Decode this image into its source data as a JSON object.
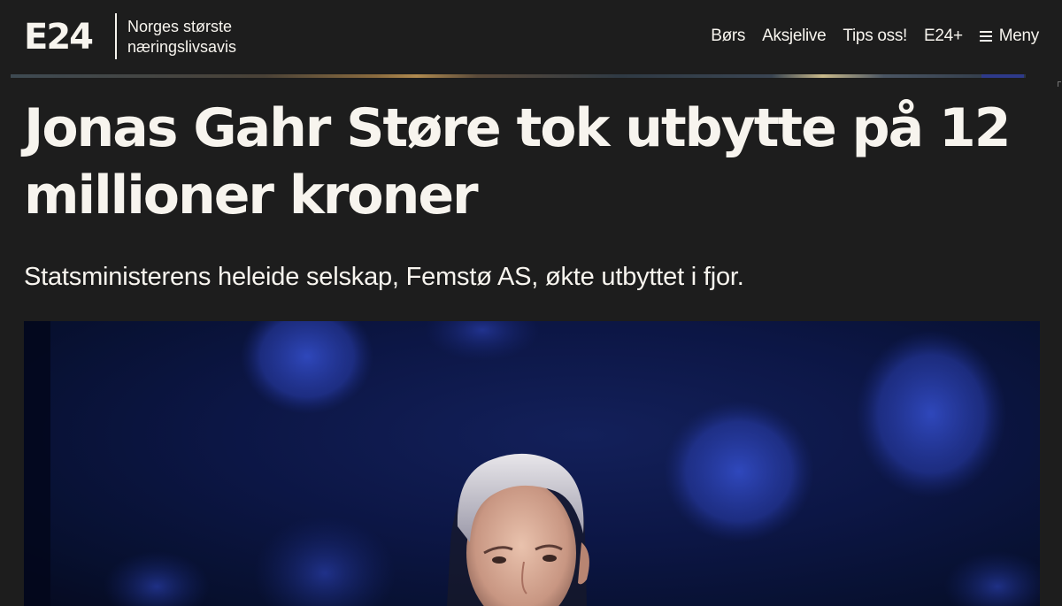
{
  "header": {
    "logo": "E24",
    "tagline_line1": "Norges største",
    "tagline_line2": "næringslivsavis",
    "nav": [
      {
        "label": "Børs"
      },
      {
        "label": "Aksjelive"
      },
      {
        "label": "Tips oss!"
      },
      {
        "label": "E24+"
      }
    ],
    "menu_label": "Meny",
    "menu_icon": "hamburger-menu-icon"
  },
  "article": {
    "headline": "Jonas Gahr Støre tok utbytte på 12 millioner kroner",
    "lead": "Statsministerens heleide selskap, Femstø AS, økte utbyttet i fjor."
  },
  "colors": {
    "background": "#1d1d1d",
    "text": "#f7f4ee",
    "hero_blue": "#0c1645",
    "bokeh_blue": "#2a3fb0"
  }
}
